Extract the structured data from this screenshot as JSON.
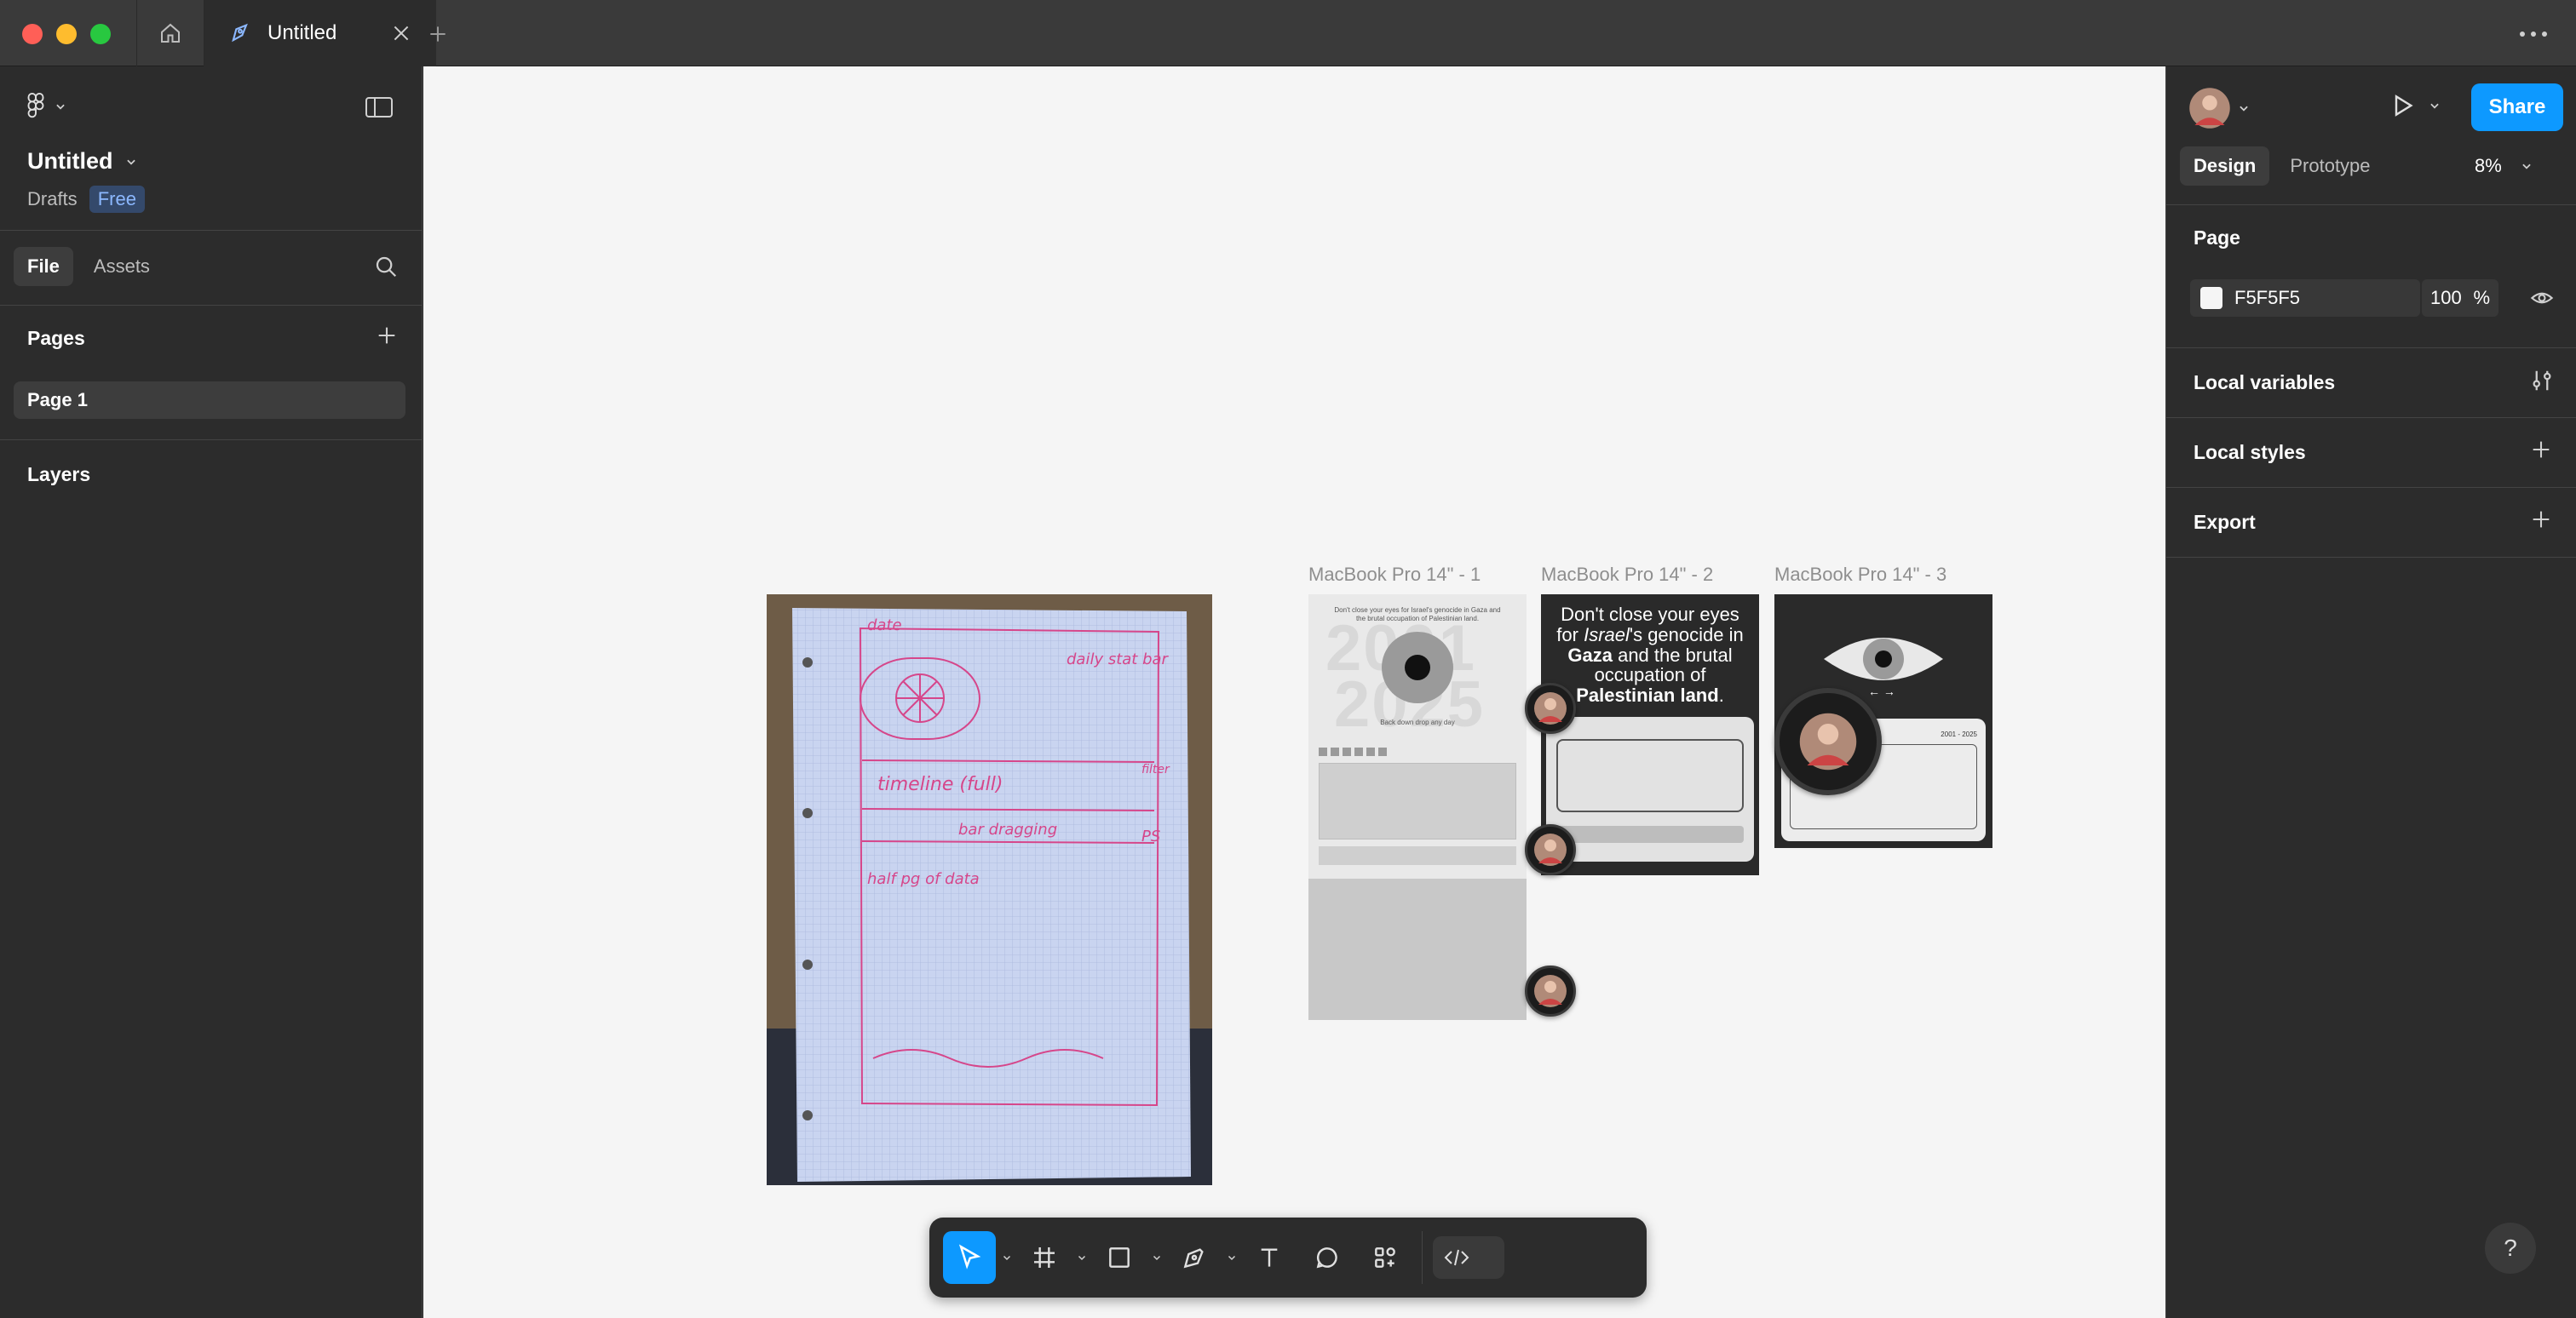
{
  "titlebar": {
    "tab_title": "Untitled",
    "new_tab_label": "+"
  },
  "left_panel": {
    "file_name": "Untitled",
    "location": "Drafts",
    "plan_badge": "Free",
    "tabs": [
      {
        "label": "File",
        "active": true
      },
      {
        "label": "Assets",
        "active": false
      }
    ],
    "pages_header": "Pages",
    "pages": [
      "Page 1"
    ],
    "layers_header": "Layers"
  },
  "canvas": {
    "background": "#F5F5F5",
    "frames": [
      {
        "label": "MacBook Pro 14\" - 1"
      },
      {
        "label": "MacBook Pro 14\" - 2"
      },
      {
        "label": "MacBook Pro 14\" - 3"
      }
    ],
    "sketch_texts": [
      "date",
      "daily stat bar",
      "timeline (full)",
      "filter",
      "bar dragging",
      "PS",
      "half pg of data"
    ],
    "frame1": {
      "heading": "Don't close your eyes for Israel's genocide in Gaza and the brutal occupation of Palestinian land.",
      "years": [
        "2001",
        "2025"
      ],
      "subtext": "Back down drop any day"
    },
    "frame2": {
      "headline_plain_1": "Don't close your eyes for",
      "headline_em": "Israel",
      "headline_plain_2": "'s genocide in",
      "headline_bold_1": "Gaza",
      "headline_plain_3": "and the brutal occupation of",
      "headline_bold_2": "Palestinian land",
      "headline_end": "."
    },
    "frame3": {
      "arrows": "← →",
      "range_label": "2001 - 2025"
    }
  },
  "toolbar": {
    "tools": [
      "move-tool",
      "frame-tool",
      "shape-tool",
      "pen-tool",
      "text-tool",
      "comment-tool",
      "actions-tool"
    ],
    "active_tool": "move-tool"
  },
  "right_panel": {
    "share_label": "Share",
    "tabs": [
      {
        "label": "Design",
        "active": true
      },
      {
        "label": "Prototype",
        "active": false
      }
    ],
    "zoom": "8%",
    "page_section": "Page",
    "page_color": "F5F5F5",
    "page_opacity": "100",
    "opacity_unit": "%",
    "sections": [
      "Local variables",
      "Local styles",
      "Export"
    ],
    "help_label": "?"
  },
  "colors": {
    "accent": "#0d99ff",
    "panel_bg": "#2c2c2c",
    "canvas_bg": "#f5f5f5",
    "titlebar_bg": "#3a3a3a",
    "sketch_ink": "#d6468a"
  }
}
